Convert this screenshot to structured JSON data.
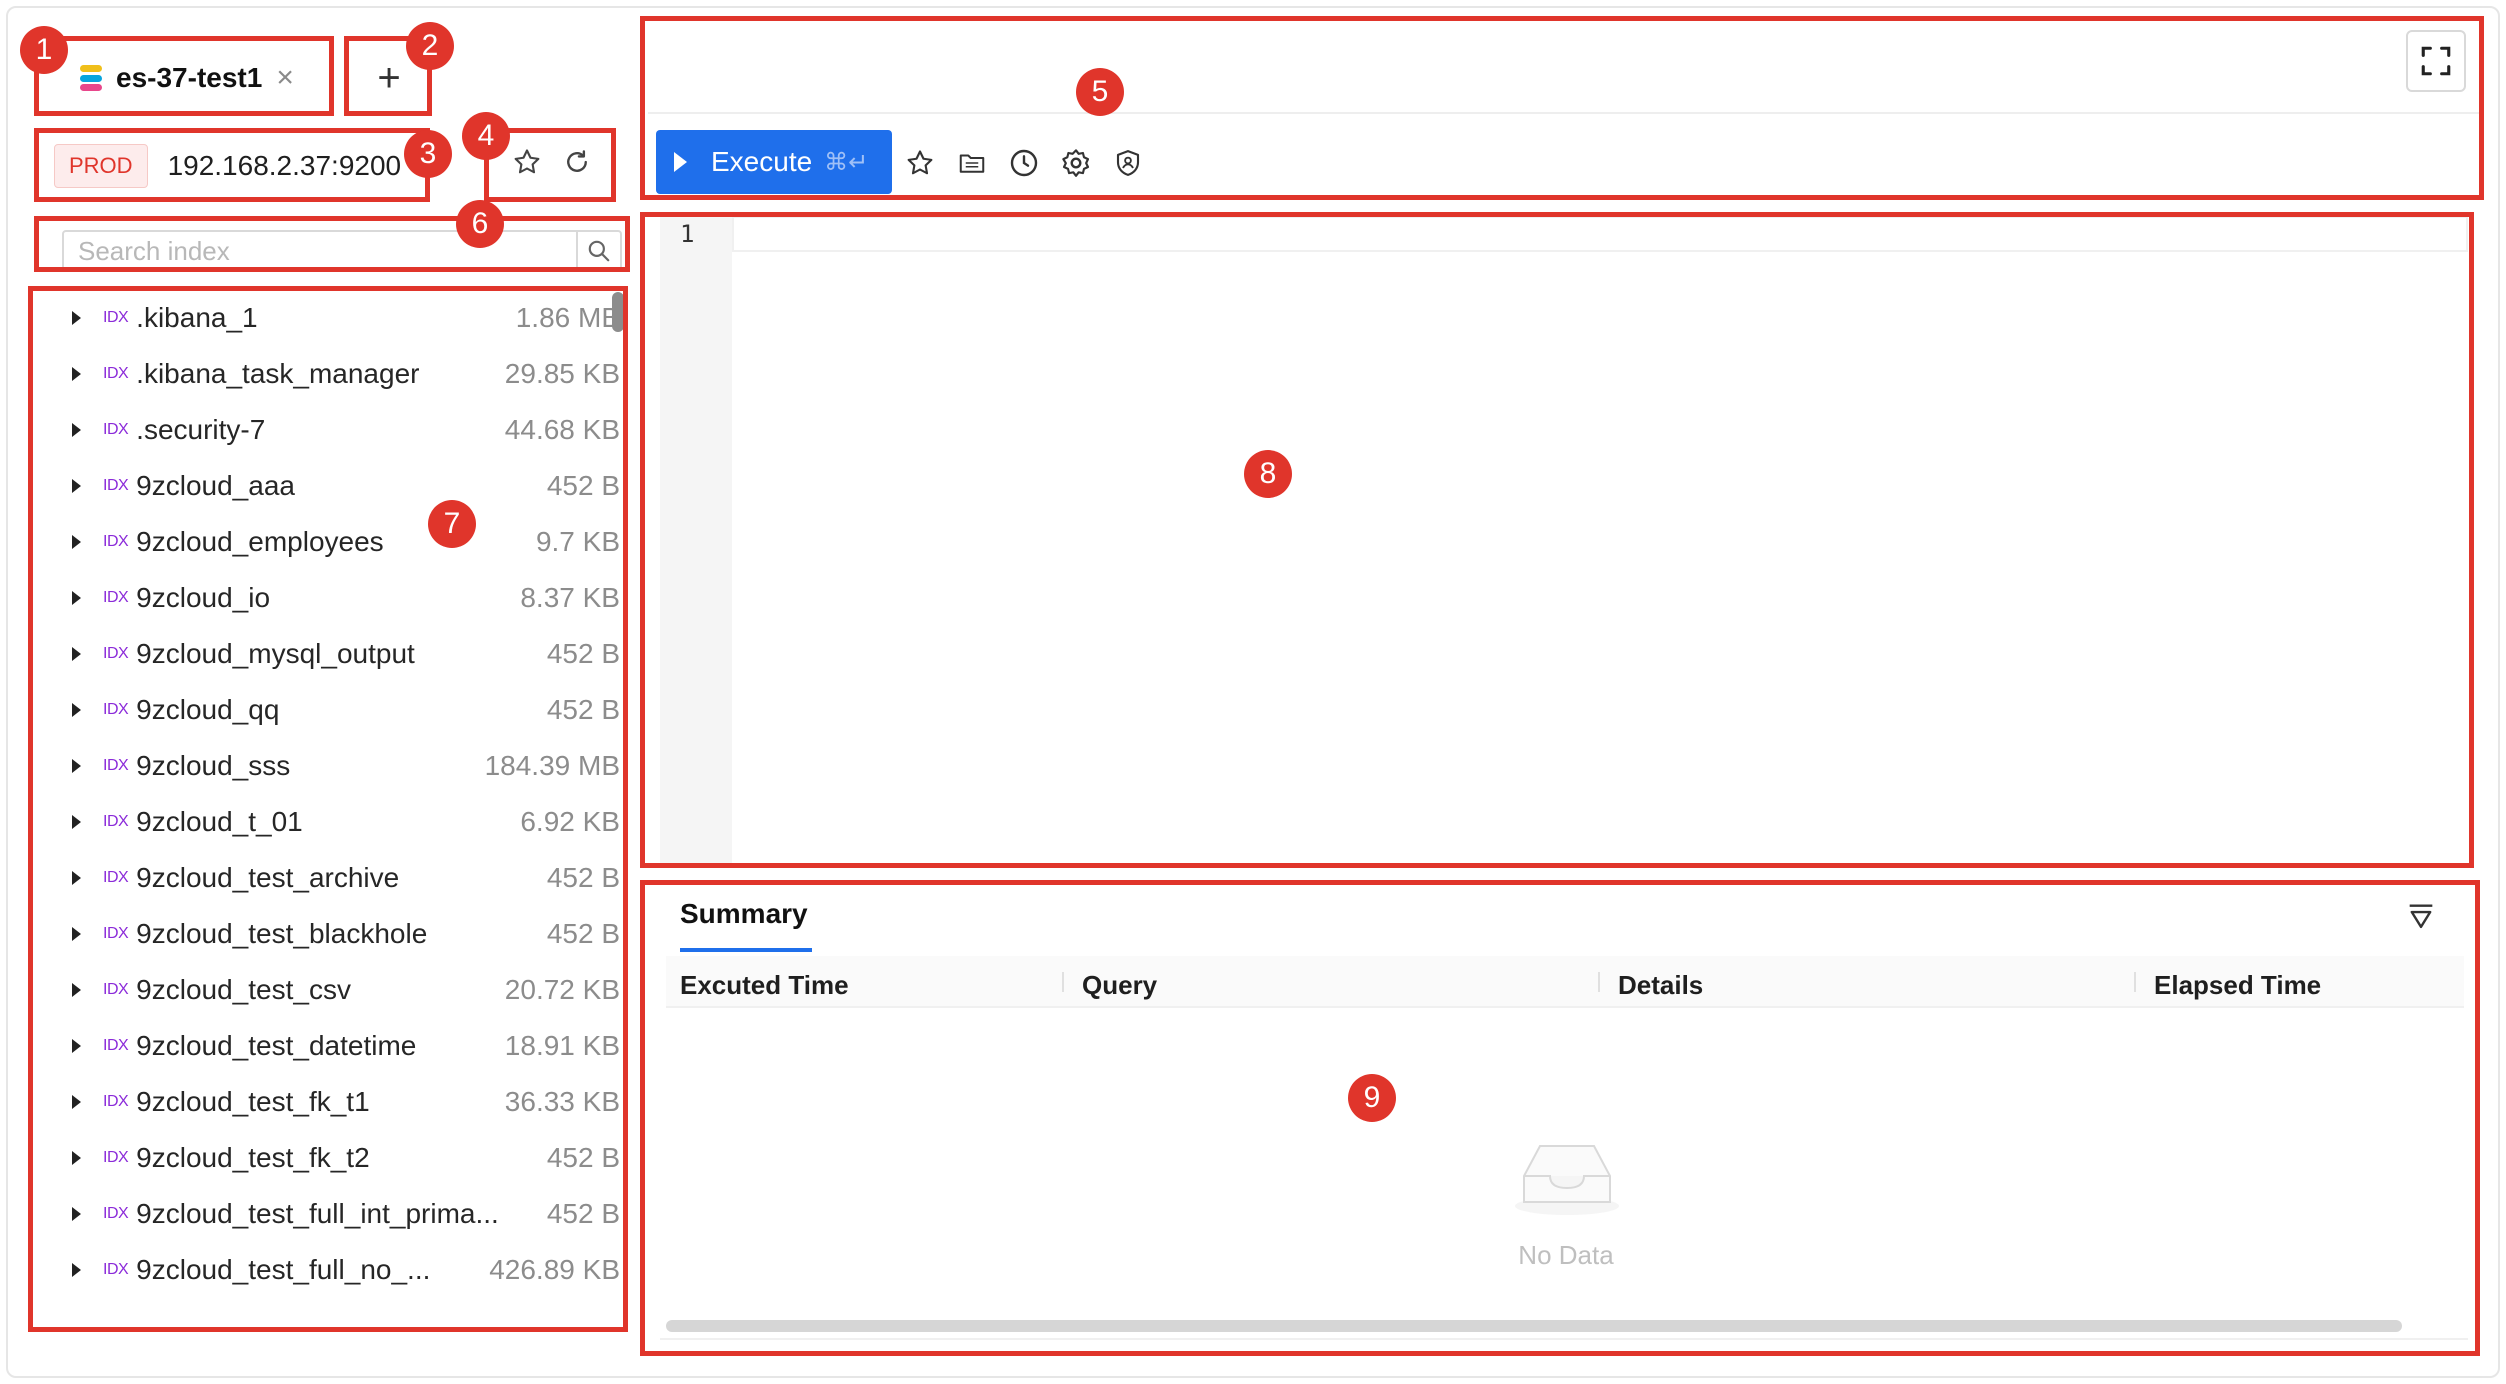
{
  "tab": {
    "title": "es-37-test1",
    "close_glyph": "×",
    "add_glyph": "+"
  },
  "connection": {
    "env": "PROD",
    "host": "192.168.2.37:9200"
  },
  "search": {
    "placeholder": "Search index"
  },
  "index_list": [
    {
      "tag": "IDX",
      "name": ".kibana_1",
      "size": "1.86 MB"
    },
    {
      "tag": "IDX",
      "name": ".kibana_task_manager",
      "size": "29.85 KB"
    },
    {
      "tag": "IDX",
      "name": ".security-7",
      "size": "44.68 KB"
    },
    {
      "tag": "IDX",
      "name": "9zcloud_aaa",
      "size": "452 B"
    },
    {
      "tag": "IDX",
      "name": "9zcloud_employees",
      "size": "9.7 KB"
    },
    {
      "tag": "IDX",
      "name": "9zcloud_io",
      "size": "8.37 KB"
    },
    {
      "tag": "IDX",
      "name": "9zcloud_mysql_output",
      "size": "452 B"
    },
    {
      "tag": "IDX",
      "name": "9zcloud_qq",
      "size": "452 B"
    },
    {
      "tag": "IDX",
      "name": "9zcloud_sss",
      "size": "184.39 MB"
    },
    {
      "tag": "IDX",
      "name": "9zcloud_t_01",
      "size": "6.92 KB"
    },
    {
      "tag": "IDX",
      "name": "9zcloud_test_archive",
      "size": "452 B"
    },
    {
      "tag": "IDX",
      "name": "9zcloud_test_blackhole",
      "size": "452 B"
    },
    {
      "tag": "IDX",
      "name": "9zcloud_test_csv",
      "size": "20.72 KB"
    },
    {
      "tag": "IDX",
      "name": "9zcloud_test_datetime",
      "size": "18.91 KB"
    },
    {
      "tag": "IDX",
      "name": "9zcloud_test_fk_t1",
      "size": "36.33 KB"
    },
    {
      "tag": "IDX",
      "name": "9zcloud_test_fk_t2",
      "size": "452 B"
    },
    {
      "tag": "IDX",
      "name": "9zcloud_test_full_int_prima...",
      "size": "452 B"
    },
    {
      "tag": "IDX",
      "name": "9zcloud_test_full_no_...",
      "size": "426.89 KB"
    }
  ],
  "toolbar": {
    "execute_label": "Execute",
    "execute_shortcut": "⌘↵",
    "icons": [
      "star-icon",
      "sql-folder-icon",
      "history-clock-icon",
      "settings-gear-icon",
      "security-shield-icon"
    ]
  },
  "editor": {
    "line_numbers": [
      "1"
    ]
  },
  "summary": {
    "tab_label": "Summary",
    "columns": [
      "Excuted Time",
      "Query",
      "Details",
      "Elapsed Time"
    ],
    "empty_text": "No Data"
  },
  "annotations": [
    "1",
    "2",
    "3",
    "4",
    "5",
    "6",
    "7",
    "8",
    "9"
  ],
  "colors": {
    "annotation": "#e0352b",
    "primary": "#1f6feb",
    "prod_tag": "#e0352b",
    "idx_tag": "#8b2bd9"
  }
}
